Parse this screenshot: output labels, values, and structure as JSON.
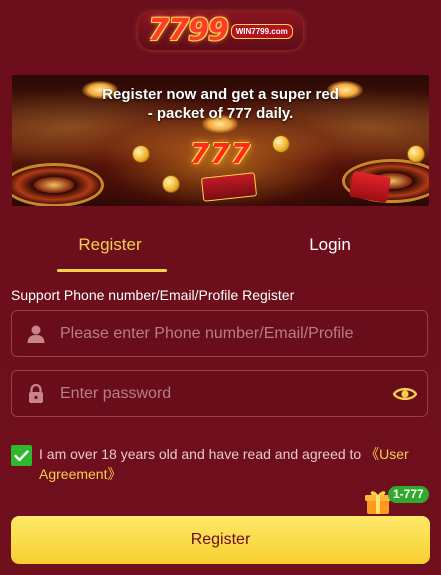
{
  "logo": {
    "main": "7799",
    "sub": "WIN7799.com"
  },
  "banner": {
    "title": "Register now and get a super red - packet of 777 daily.",
    "sevens": "777"
  },
  "tabs": [
    {
      "label": "Register",
      "active": true
    },
    {
      "label": "Login",
      "active": false
    }
  ],
  "form": {
    "support_text": "Support Phone number/Email/Profile Register",
    "account_placeholder": "Please enter Phone number/Email/Profile",
    "password_placeholder": "Enter password",
    "agreement_text": "I am over 18 years old and have read and agreed to ",
    "agreement_link": "《User Agreement》",
    "agreement_checked": true,
    "submit_label": "Register"
  },
  "gift": {
    "badge": "1-777"
  },
  "colors": {
    "background": "#6e0f1d",
    "accent": "#f5d04c",
    "button": "#f9dd45",
    "checkbox": "#2eb82e"
  },
  "icons": {
    "account": "user-icon",
    "password": "lock-icon",
    "toggle": "eye-icon",
    "check": "check-icon",
    "gift": "gift-icon"
  }
}
